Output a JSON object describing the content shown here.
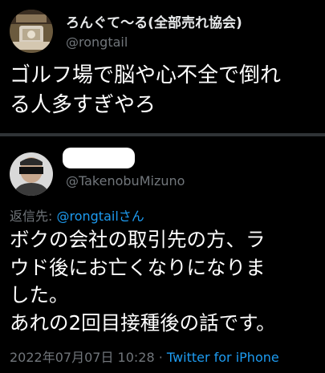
{
  "original_tweet": {
    "display_name": "ろんぐて〜る(全部売れ協会)",
    "handle": "@rongtail",
    "text_lines": [
      "ゴルフ場で脳や心不全で倒れ",
      "る人多すぎやろ"
    ]
  },
  "reply_tweet": {
    "handle": "@TakenobuMizuno",
    "reply_prefix": "返信先: ",
    "reply_to": "@rongtail",
    "reply_suffix": "さん",
    "text_lines": [
      "ボクの会社の取引先の方、ラ",
      "ウド後にお亡くなりになりま",
      "した。",
      "あれの2回目接種後の話です。"
    ],
    "timestamp": "2022年07月07日 10:28",
    "separator": " · ",
    "source": "Twitter for iPhone"
  },
  "colors": {
    "background": "#000000",
    "text": "#e7e9ea",
    "secondary_text": "#71767b",
    "link": "#1d9bf0",
    "divider": "#2f3336"
  }
}
